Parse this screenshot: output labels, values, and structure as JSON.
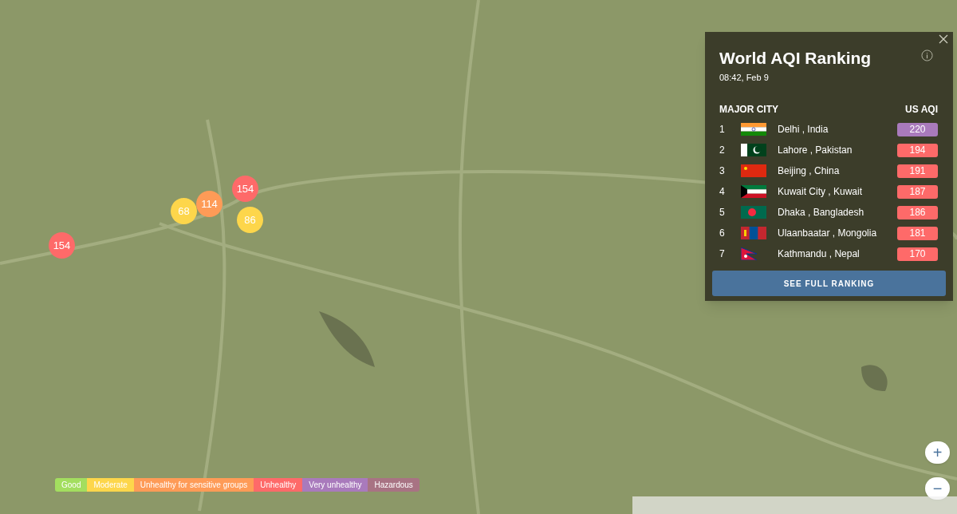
{
  "map_markers": [
    {
      "value": "154",
      "color": "#fe6a69"
    },
    {
      "value": "114",
      "color": "#fe9b57"
    },
    {
      "value": "68",
      "color": "#fdd64b"
    },
    {
      "value": "154",
      "color": "#fe6a69"
    },
    {
      "value": "86",
      "color": "#fdd64b"
    }
  ],
  "ranking_panel": {
    "title": "World AQI Ranking",
    "timestamp": "08:42, Feb 9",
    "columns": [
      "MAJOR CITY",
      "US AQI"
    ],
    "rows": [
      {
        "rank": "1",
        "kind": "india",
        "city": "Delhi , India",
        "aqi": "220",
        "color": "#a97abc"
      },
      {
        "rank": "2",
        "kind": "pakistan",
        "city": "Lahore , Pakistan",
        "aqi": "194",
        "color": "#fe6a69"
      },
      {
        "rank": "3",
        "kind": "china",
        "city": "Beijing , China",
        "aqi": "191",
        "color": "#fe6a69"
      },
      {
        "rank": "4",
        "kind": "kuwait",
        "city": "Kuwait City , Kuwait",
        "aqi": "187",
        "color": "#fe6a69"
      },
      {
        "rank": "5",
        "kind": "bangladesh",
        "city": "Dhaka , Bangladesh",
        "aqi": "186",
        "color": "#fe6a69"
      },
      {
        "rank": "6",
        "kind": "mongolia",
        "city": "Ulaanbaatar , Mongolia",
        "aqi": "181",
        "color": "#fe6a69"
      },
      {
        "rank": "7",
        "kind": "nepal",
        "city": "Kathmandu , Nepal",
        "aqi": "170",
        "color": "#fe6a69"
      }
    ],
    "button": "SEE FULL RANKING"
  },
  "zoom_controls": [
    "+",
    "−"
  ],
  "legend": [
    {
      "label": "Good",
      "color": "#a3de5f"
    },
    {
      "label": "Moderate",
      "color": "#fdd64b"
    },
    {
      "label": "Unhealthy for sensitive groups",
      "color": "#fe9b57"
    },
    {
      "label": "Unhealthy",
      "color": "#fe6a69"
    },
    {
      "label": "Very unhealthy",
      "color": "#a97abc"
    },
    {
      "label": "Hazardous",
      "color": "#a87383"
    }
  ]
}
